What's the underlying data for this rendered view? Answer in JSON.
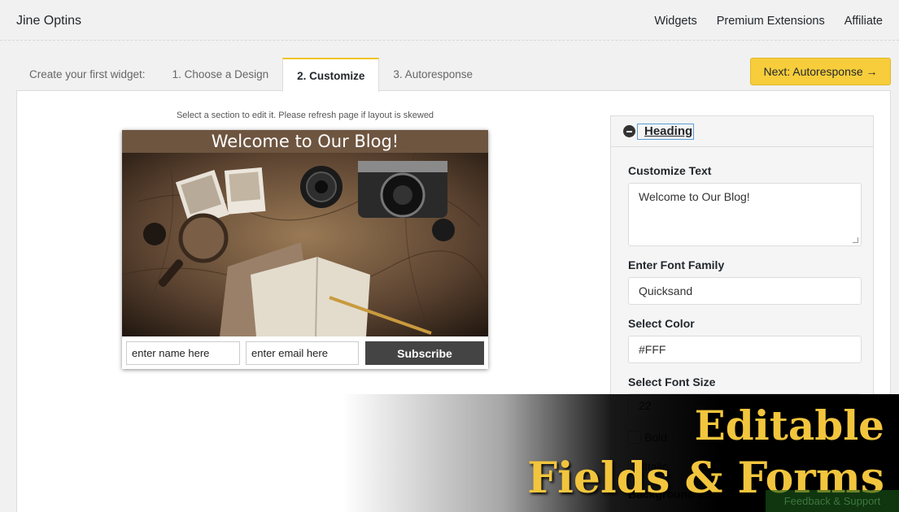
{
  "app": {
    "title": "Jine Optins"
  },
  "topnav": {
    "items": [
      "Widgets",
      "Premium Extensions",
      "Affiliate"
    ]
  },
  "tabs": {
    "lead": "Create your first widget:",
    "items": [
      "1. Choose a Design",
      "2. Customize",
      "3. Autoresponse"
    ],
    "active_index": 1
  },
  "next_button": {
    "label": "Next: Autoresponse →"
  },
  "hint": "Select a section to edit it. Please refresh page if layout is skewed",
  "widget": {
    "heading": "Welcome to Our Blog!",
    "heading_bg": "#6e5540",
    "name_placeholder": "enter name here",
    "email_placeholder": "enter email here",
    "subscribe_label": "Subscribe"
  },
  "panel": {
    "section_title": "Heading",
    "fields": {
      "customize_text_label": "Customize Text",
      "customize_text_value": "Welcome to Our Blog!",
      "font_family_label": "Enter Font Family",
      "font_family_value": "Quicksand",
      "color_label": "Select Color",
      "color_value": "#FFF",
      "font_size_label": "Select Font Size",
      "font_size_value": "22",
      "bold_label": "Bold",
      "italic_label": "Italic",
      "bg_color_label": "Background Color"
    }
  },
  "banner": {
    "line1": "Editable",
    "line2": "Fields & Forms"
  },
  "feedback": {
    "label": "Feedback & Support"
  },
  "colors": {
    "accent": "#f7cd3b",
    "banner_text": "#f2c53d",
    "subscribe_bg": "#444444"
  }
}
